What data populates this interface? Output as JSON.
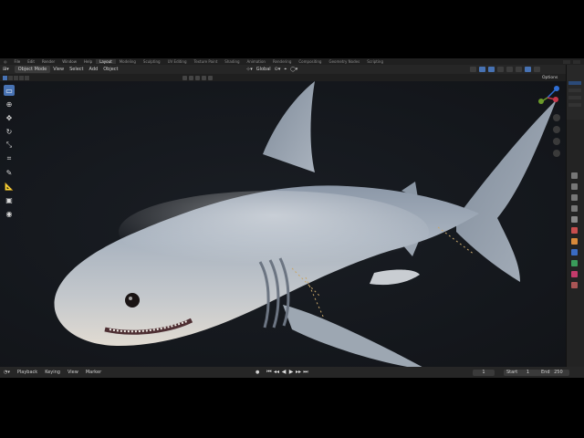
{
  "menubar": {
    "items": [
      "File",
      "Edit",
      "Render",
      "Window",
      "Help"
    ],
    "workspaces": [
      "Layout",
      "Modeling",
      "Sculpting",
      "UV Editing",
      "Texture Paint",
      "Shading",
      "Animation",
      "Rendering",
      "Compositing",
      "Geometry Nodes",
      "Scripting"
    ],
    "active_workspace": "Layout"
  },
  "header": {
    "mode": "Object Mode",
    "menus": [
      "View",
      "Select",
      "Add",
      "Object"
    ],
    "orientation": "Global"
  },
  "header2": {
    "options": "Options"
  },
  "timeline": {
    "menus": [
      "Playback",
      "Keying",
      "View",
      "Marker"
    ],
    "current_frame": "1",
    "start_label": "Start",
    "start_value": "1",
    "end_label": "End",
    "end_value": "250"
  },
  "colors": {
    "accent": "#4772b3",
    "background": "#14171c",
    "axis_x": "#c8374a",
    "axis_y": "#6b9a2a",
    "axis_z": "#2f6fd6"
  },
  "icons": {
    "tools": [
      "select-box-icon",
      "cursor-icon",
      "move-icon",
      "rotate-icon",
      "scale-icon",
      "transform-icon",
      "annotate-icon",
      "measure-icon",
      "add-cube-icon",
      "add-object-icon"
    ]
  }
}
